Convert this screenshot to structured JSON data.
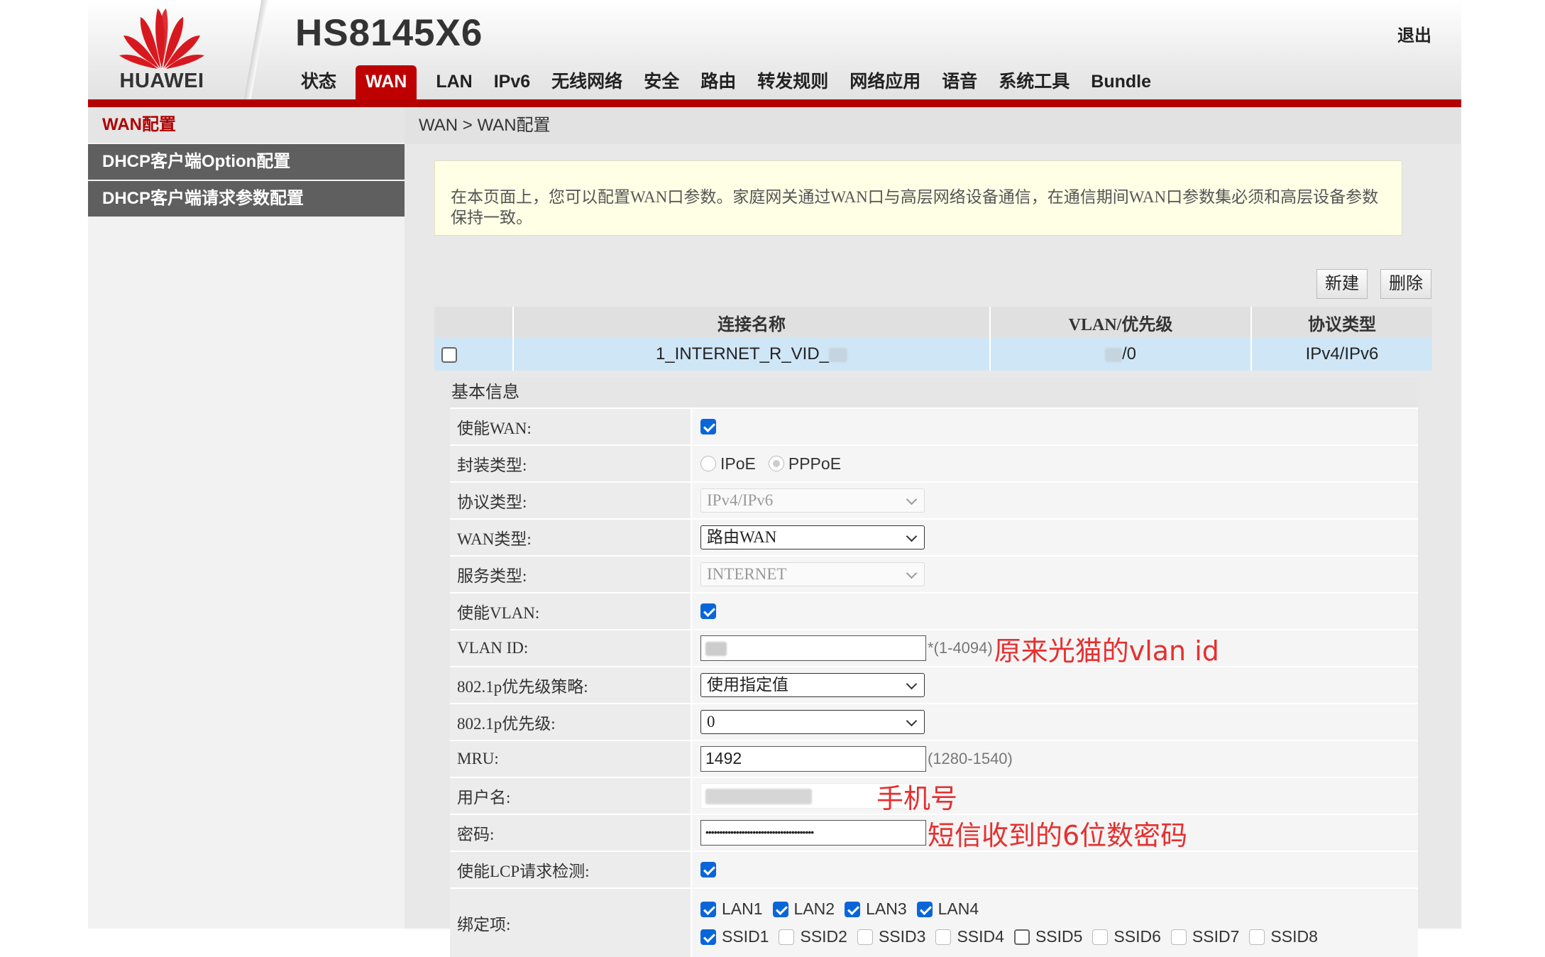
{
  "header": {
    "brand": "HUAWEI",
    "model": "HS8145X6",
    "logout": "退出",
    "nav": [
      "状态",
      "WAN",
      "LAN",
      "IPv6",
      "无线网络",
      "安全",
      "路由",
      "转发规则",
      "网络应用",
      "语音",
      "系统工具",
      "Bundle"
    ],
    "nav_active": "WAN",
    "accent_color": "#be0000"
  },
  "sidebar": {
    "items": [
      {
        "label": "WAN配置",
        "active": true
      },
      {
        "label": "DHCP客户端Option配置",
        "active": false
      },
      {
        "label": "DHCP客户端请求参数配置",
        "active": false
      }
    ]
  },
  "breadcrumb": "WAN > WAN配置",
  "notice": "在本页面上，您可以配置WAN口参数。家庭网关通过WAN口与高层网络设备通信，在通信期间WAN口参数集必须和高层设备参数保持一致。",
  "actions": {
    "new": "新建",
    "delete": "删除"
  },
  "wan_table": {
    "headers": [
      "连接名称",
      "VLAN/优先级",
      "协议类型"
    ],
    "rows": [
      {
        "name": "1_INTERNET_R_VID_",
        "vlan_priority": "/0",
        "protocol": "IPv4/IPv6",
        "selected": false
      }
    ]
  },
  "form": {
    "section_title": "基本信息",
    "enable_wan": {
      "label": "使能WAN:",
      "checked": true
    },
    "encap": {
      "label": "封装类型:",
      "options": [
        "IPoE",
        "PPPoE"
      ],
      "selected": "PPPoE"
    },
    "protocol": {
      "label": "协议类型:",
      "value": "IPv4/IPv6"
    },
    "wan_type": {
      "label": "WAN类型:",
      "value": "路由WAN"
    },
    "service_type": {
      "label": "服务类型:",
      "value": "INTERNET"
    },
    "enable_vlan": {
      "label": "使能VLAN:",
      "checked": true
    },
    "vlan_id": {
      "label": "VLAN ID:",
      "hint": "*(1-4094)",
      "annotation": "原来光猫的vlan id"
    },
    "priority_policy": {
      "label": "802.1p优先级策略:",
      "value": "使用指定值"
    },
    "priority": {
      "label": "802.1p优先级:",
      "value": "0"
    },
    "mru": {
      "label": "MRU:",
      "value": "1492",
      "hint": "(1280-1540)"
    },
    "username": {
      "label": "用户名:",
      "annotation": "手机号"
    },
    "password": {
      "label": "密码:",
      "value": "•••••••••••••••••••••••••••••••••••••••",
      "annotation": "短信收到的6位数密码"
    },
    "lcp": {
      "label": "使能LCP请求检测:",
      "checked": true
    },
    "binding": {
      "label": "绑定项:",
      "lan": [
        {
          "name": "LAN1",
          "checked": true
        },
        {
          "name": "LAN2",
          "checked": true
        },
        {
          "name": "LAN3",
          "checked": true
        },
        {
          "name": "LAN4",
          "checked": true
        }
      ],
      "ssid": [
        {
          "name": "SSID1",
          "checked": true
        },
        {
          "name": "SSID2",
          "checked": false
        },
        {
          "name": "SSID3",
          "checked": false
        },
        {
          "name": "SSID4",
          "checked": false
        },
        {
          "name": "SSID5",
          "checked": false
        },
        {
          "name": "SSID6",
          "checked": false
        },
        {
          "name": "SSID7",
          "checked": false
        },
        {
          "name": "SSID8",
          "checked": false
        }
      ]
    }
  }
}
